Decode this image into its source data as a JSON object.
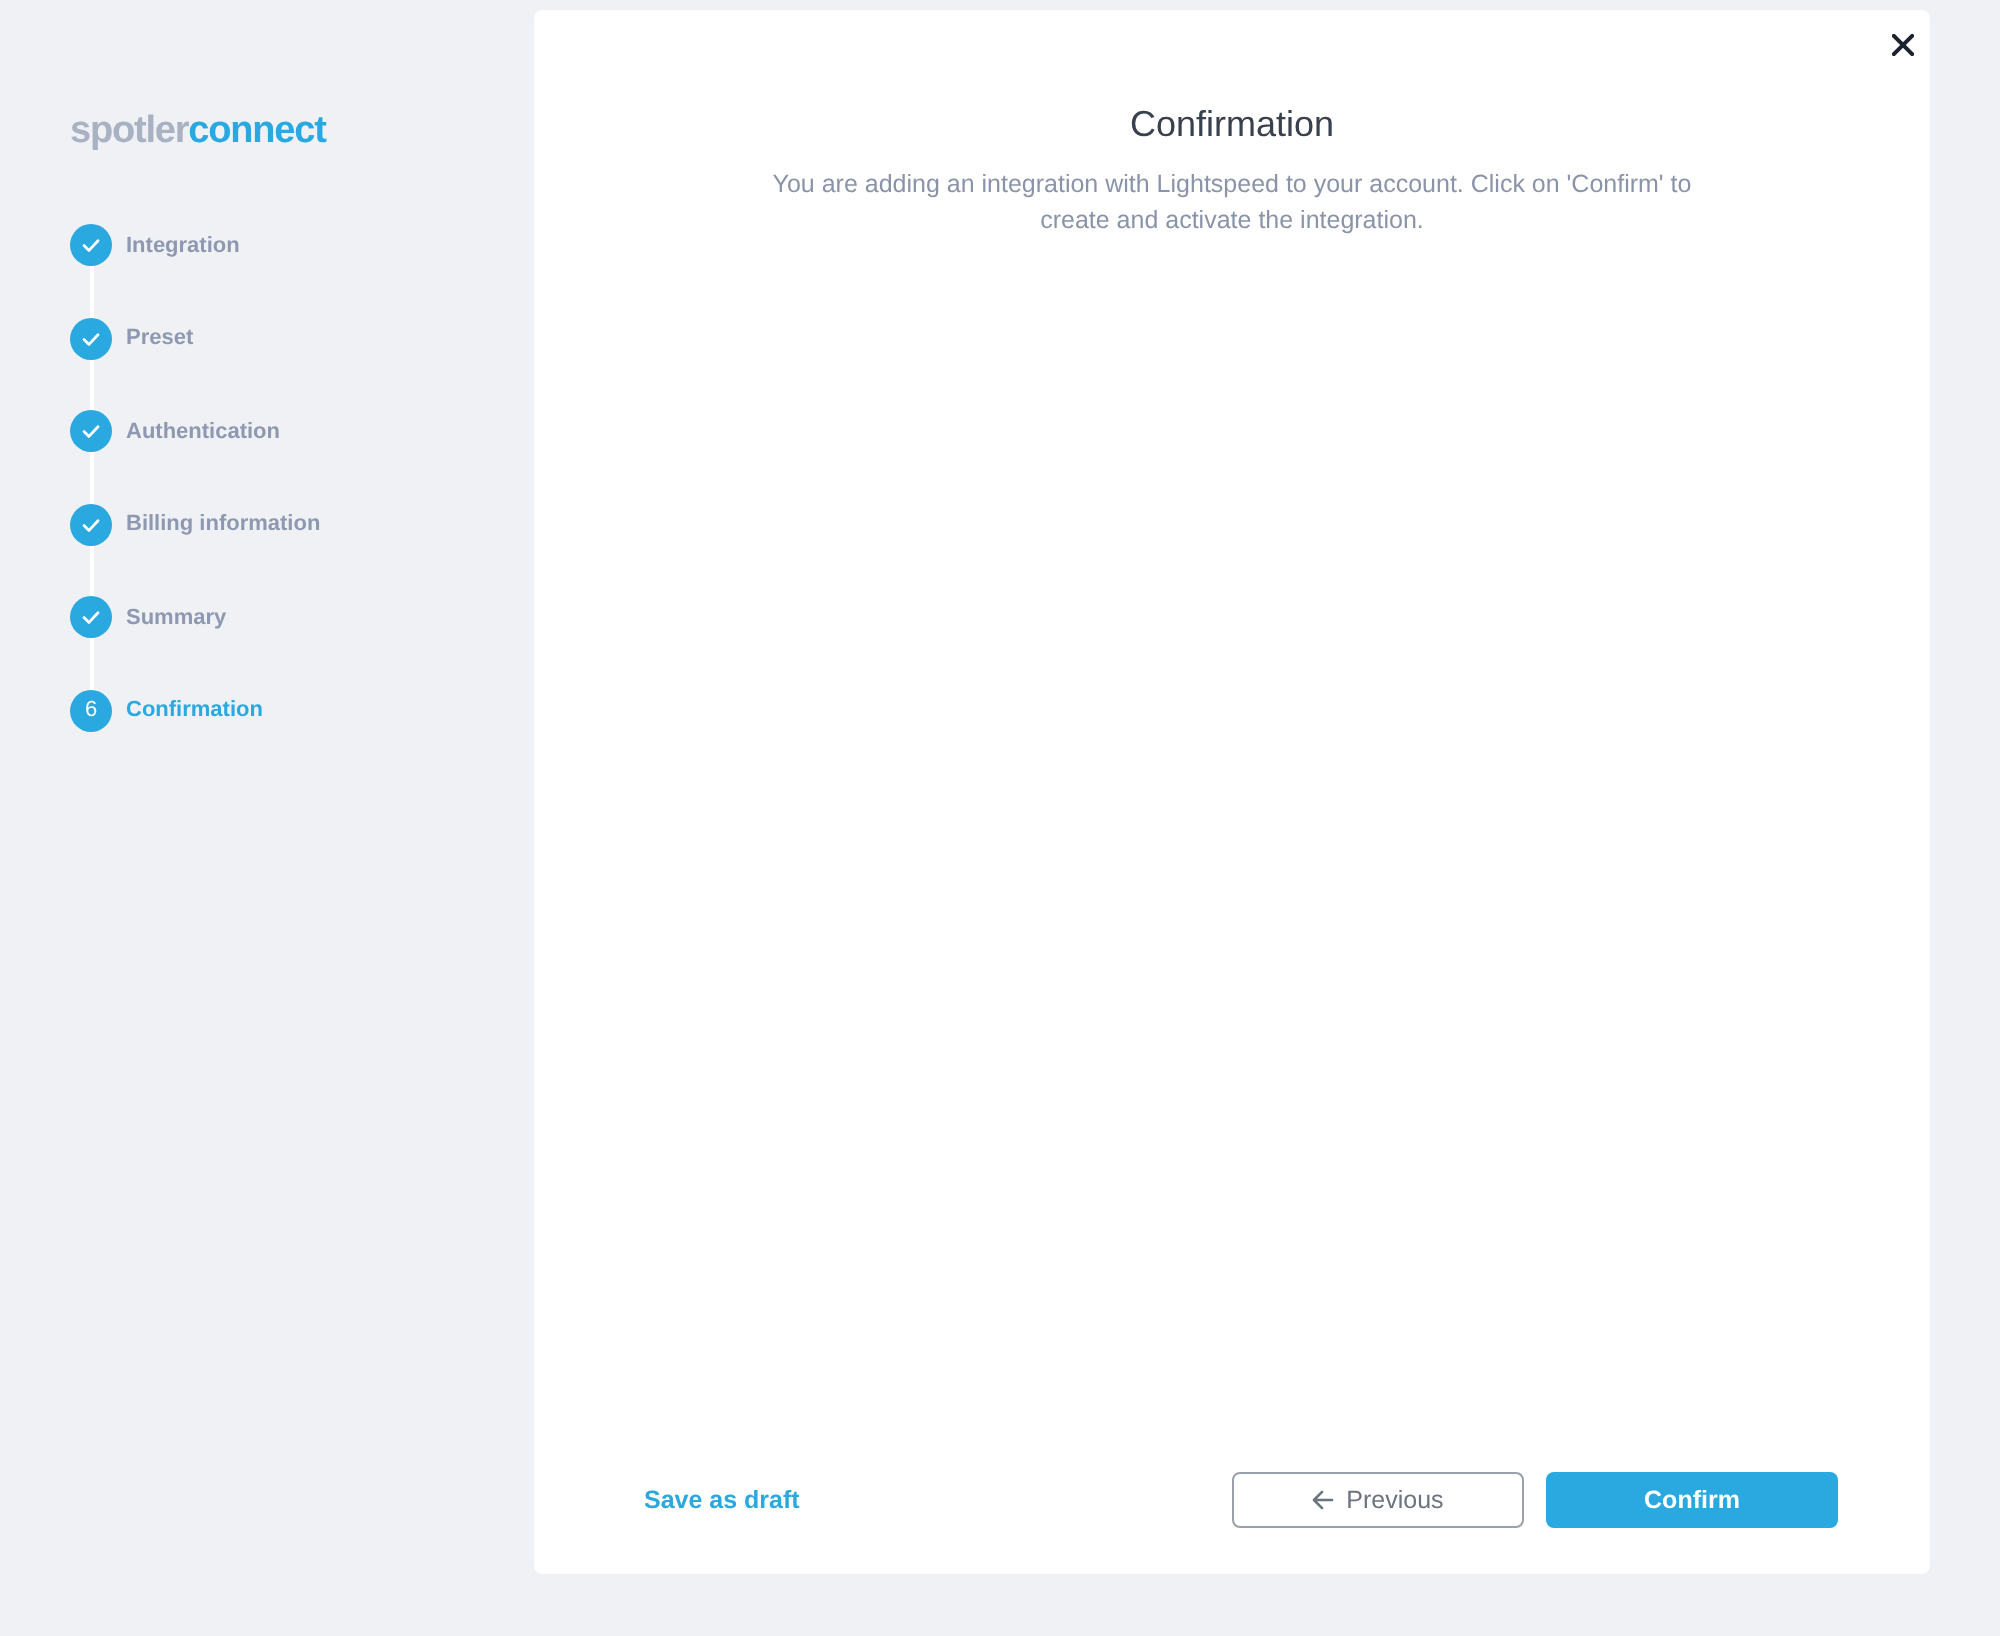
{
  "logo": {
    "parts": [
      {
        "text": "spotler",
        "kind": "light"
      },
      {
        "text": "connect",
        "kind": "accent"
      }
    ]
  },
  "steps": [
    {
      "label": "Integration",
      "completed": true,
      "selected": false
    },
    {
      "label": "Preset",
      "completed": true,
      "selected": false
    },
    {
      "label": "Authentication",
      "completed": true,
      "selected": false
    },
    {
      "label": "Billing information",
      "completed": true,
      "selected": false
    },
    {
      "label": "Summary",
      "completed": true,
      "selected": false
    },
    {
      "label": "Confirmation",
      "number": "6",
      "completed": false,
      "selected": true
    }
  ],
  "dialog": {
    "title": "Confirmation",
    "description": "You are adding an integration with Lightspeed to your account. Click on 'Confirm' to create and activate the integration."
  },
  "footer": {
    "draft_link": "Save as draft",
    "previous_button": "Previous",
    "confirm_button": "Confirm"
  }
}
